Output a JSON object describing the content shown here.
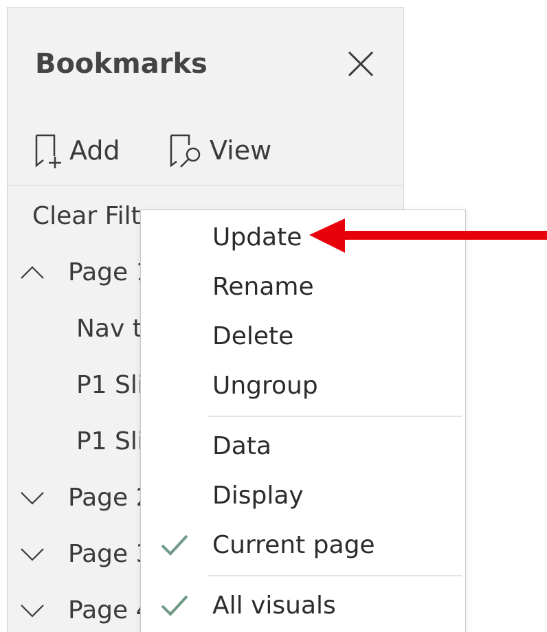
{
  "pane": {
    "title": "Bookmarks",
    "add_label": "Add",
    "view_label": "View",
    "clear_filter": "Clear Filte",
    "groups": [
      {
        "label": "Page 1",
        "expanded": true,
        "icon": "chevron-up-icon"
      },
      {
        "label": "Page 2",
        "expanded": false,
        "icon": "chevron-down-icon"
      },
      {
        "label": "Page 3",
        "expanded": false,
        "icon": "chevron-down-icon"
      },
      {
        "label": "Page 4",
        "expanded": false,
        "icon": "chevron-down-icon"
      }
    ],
    "children": [
      {
        "label": "Nav t"
      },
      {
        "label": "P1 Sli"
      },
      {
        "label": "P1 Sli"
      }
    ]
  },
  "context_menu": {
    "items": [
      {
        "label": "Update",
        "checked": false
      },
      {
        "label": "Rename",
        "checked": false
      },
      {
        "label": "Delete",
        "checked": false
      },
      {
        "label": "Ungroup",
        "checked": false
      },
      {
        "label": "Data",
        "checked": false
      },
      {
        "label": "Display",
        "checked": false
      },
      {
        "label": "Current page",
        "checked": true
      },
      {
        "label": "All visuals",
        "checked": true
      }
    ]
  },
  "colors": {
    "pane_bg": "#f2f2f2",
    "text": "#3a3a3a",
    "check": "#6e9a86",
    "arrow": "#e8000b"
  },
  "icons": {
    "close": "close-icon",
    "add": "bookmark-add-icon",
    "view": "bookmark-view-icon",
    "check": "checkmark-icon",
    "arrow": "red-arrow-annotation"
  }
}
